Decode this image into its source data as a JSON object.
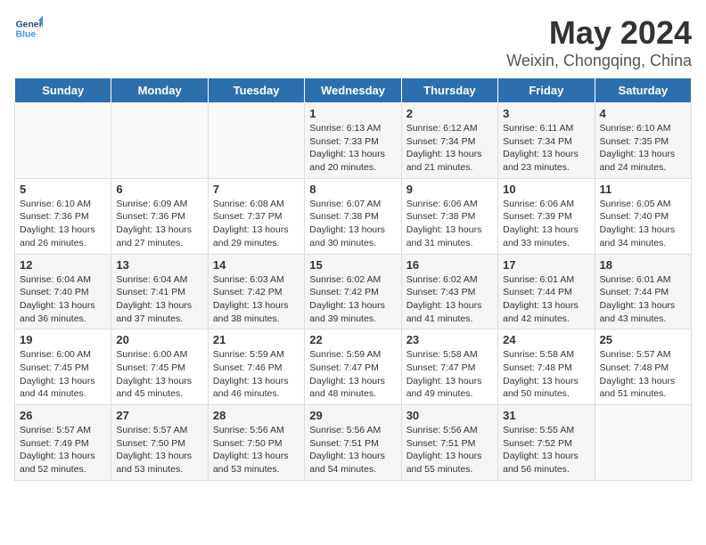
{
  "logo": {
    "line1": "General",
    "line2": "Blue"
  },
  "title": "May 2024",
  "subtitle": "Weixin, Chongqing, China",
  "weekdays": [
    "Sunday",
    "Monday",
    "Tuesday",
    "Wednesday",
    "Thursday",
    "Friday",
    "Saturday"
  ],
  "weeks": [
    [
      {
        "day": "",
        "info": ""
      },
      {
        "day": "",
        "info": ""
      },
      {
        "day": "",
        "info": ""
      },
      {
        "day": "1",
        "info": "Sunrise: 6:13 AM\nSunset: 7:33 PM\nDaylight: 13 hours\nand 20 minutes."
      },
      {
        "day": "2",
        "info": "Sunrise: 6:12 AM\nSunset: 7:34 PM\nDaylight: 13 hours\nand 21 minutes."
      },
      {
        "day": "3",
        "info": "Sunrise: 6:11 AM\nSunset: 7:34 PM\nDaylight: 13 hours\nand 23 minutes."
      },
      {
        "day": "4",
        "info": "Sunrise: 6:10 AM\nSunset: 7:35 PM\nDaylight: 13 hours\nand 24 minutes."
      }
    ],
    [
      {
        "day": "5",
        "info": "Sunrise: 6:10 AM\nSunset: 7:36 PM\nDaylight: 13 hours\nand 26 minutes."
      },
      {
        "day": "6",
        "info": "Sunrise: 6:09 AM\nSunset: 7:36 PM\nDaylight: 13 hours\nand 27 minutes."
      },
      {
        "day": "7",
        "info": "Sunrise: 6:08 AM\nSunset: 7:37 PM\nDaylight: 13 hours\nand 29 minutes."
      },
      {
        "day": "8",
        "info": "Sunrise: 6:07 AM\nSunset: 7:38 PM\nDaylight: 13 hours\nand 30 minutes."
      },
      {
        "day": "9",
        "info": "Sunrise: 6:06 AM\nSunset: 7:38 PM\nDaylight: 13 hours\nand 31 minutes."
      },
      {
        "day": "10",
        "info": "Sunrise: 6:06 AM\nSunset: 7:39 PM\nDaylight: 13 hours\nand 33 minutes."
      },
      {
        "day": "11",
        "info": "Sunrise: 6:05 AM\nSunset: 7:40 PM\nDaylight: 13 hours\nand 34 minutes."
      }
    ],
    [
      {
        "day": "12",
        "info": "Sunrise: 6:04 AM\nSunset: 7:40 PM\nDaylight: 13 hours\nand 36 minutes."
      },
      {
        "day": "13",
        "info": "Sunrise: 6:04 AM\nSunset: 7:41 PM\nDaylight: 13 hours\nand 37 minutes."
      },
      {
        "day": "14",
        "info": "Sunrise: 6:03 AM\nSunset: 7:42 PM\nDaylight: 13 hours\nand 38 minutes."
      },
      {
        "day": "15",
        "info": "Sunrise: 6:02 AM\nSunset: 7:42 PM\nDaylight: 13 hours\nand 39 minutes."
      },
      {
        "day": "16",
        "info": "Sunrise: 6:02 AM\nSunset: 7:43 PM\nDaylight: 13 hours\nand 41 minutes."
      },
      {
        "day": "17",
        "info": "Sunrise: 6:01 AM\nSunset: 7:44 PM\nDaylight: 13 hours\nand 42 minutes."
      },
      {
        "day": "18",
        "info": "Sunrise: 6:01 AM\nSunset: 7:44 PM\nDaylight: 13 hours\nand 43 minutes."
      }
    ],
    [
      {
        "day": "19",
        "info": "Sunrise: 6:00 AM\nSunset: 7:45 PM\nDaylight: 13 hours\nand 44 minutes."
      },
      {
        "day": "20",
        "info": "Sunrise: 6:00 AM\nSunset: 7:45 PM\nDaylight: 13 hours\nand 45 minutes."
      },
      {
        "day": "21",
        "info": "Sunrise: 5:59 AM\nSunset: 7:46 PM\nDaylight: 13 hours\nand 46 minutes."
      },
      {
        "day": "22",
        "info": "Sunrise: 5:59 AM\nSunset: 7:47 PM\nDaylight: 13 hours\nand 48 minutes."
      },
      {
        "day": "23",
        "info": "Sunrise: 5:58 AM\nSunset: 7:47 PM\nDaylight: 13 hours\nand 49 minutes."
      },
      {
        "day": "24",
        "info": "Sunrise: 5:58 AM\nSunset: 7:48 PM\nDaylight: 13 hours\nand 50 minutes."
      },
      {
        "day": "25",
        "info": "Sunrise: 5:57 AM\nSunset: 7:48 PM\nDaylight: 13 hours\nand 51 minutes."
      }
    ],
    [
      {
        "day": "26",
        "info": "Sunrise: 5:57 AM\nSunset: 7:49 PM\nDaylight: 13 hours\nand 52 minutes."
      },
      {
        "day": "27",
        "info": "Sunrise: 5:57 AM\nSunset: 7:50 PM\nDaylight: 13 hours\nand 53 minutes."
      },
      {
        "day": "28",
        "info": "Sunrise: 5:56 AM\nSunset: 7:50 PM\nDaylight: 13 hours\nand 53 minutes."
      },
      {
        "day": "29",
        "info": "Sunrise: 5:56 AM\nSunset: 7:51 PM\nDaylight: 13 hours\nand 54 minutes."
      },
      {
        "day": "30",
        "info": "Sunrise: 5:56 AM\nSunset: 7:51 PM\nDaylight: 13 hours\nand 55 minutes."
      },
      {
        "day": "31",
        "info": "Sunrise: 5:55 AM\nSunset: 7:52 PM\nDaylight: 13 hours\nand 56 minutes."
      },
      {
        "day": "",
        "info": ""
      }
    ]
  ]
}
